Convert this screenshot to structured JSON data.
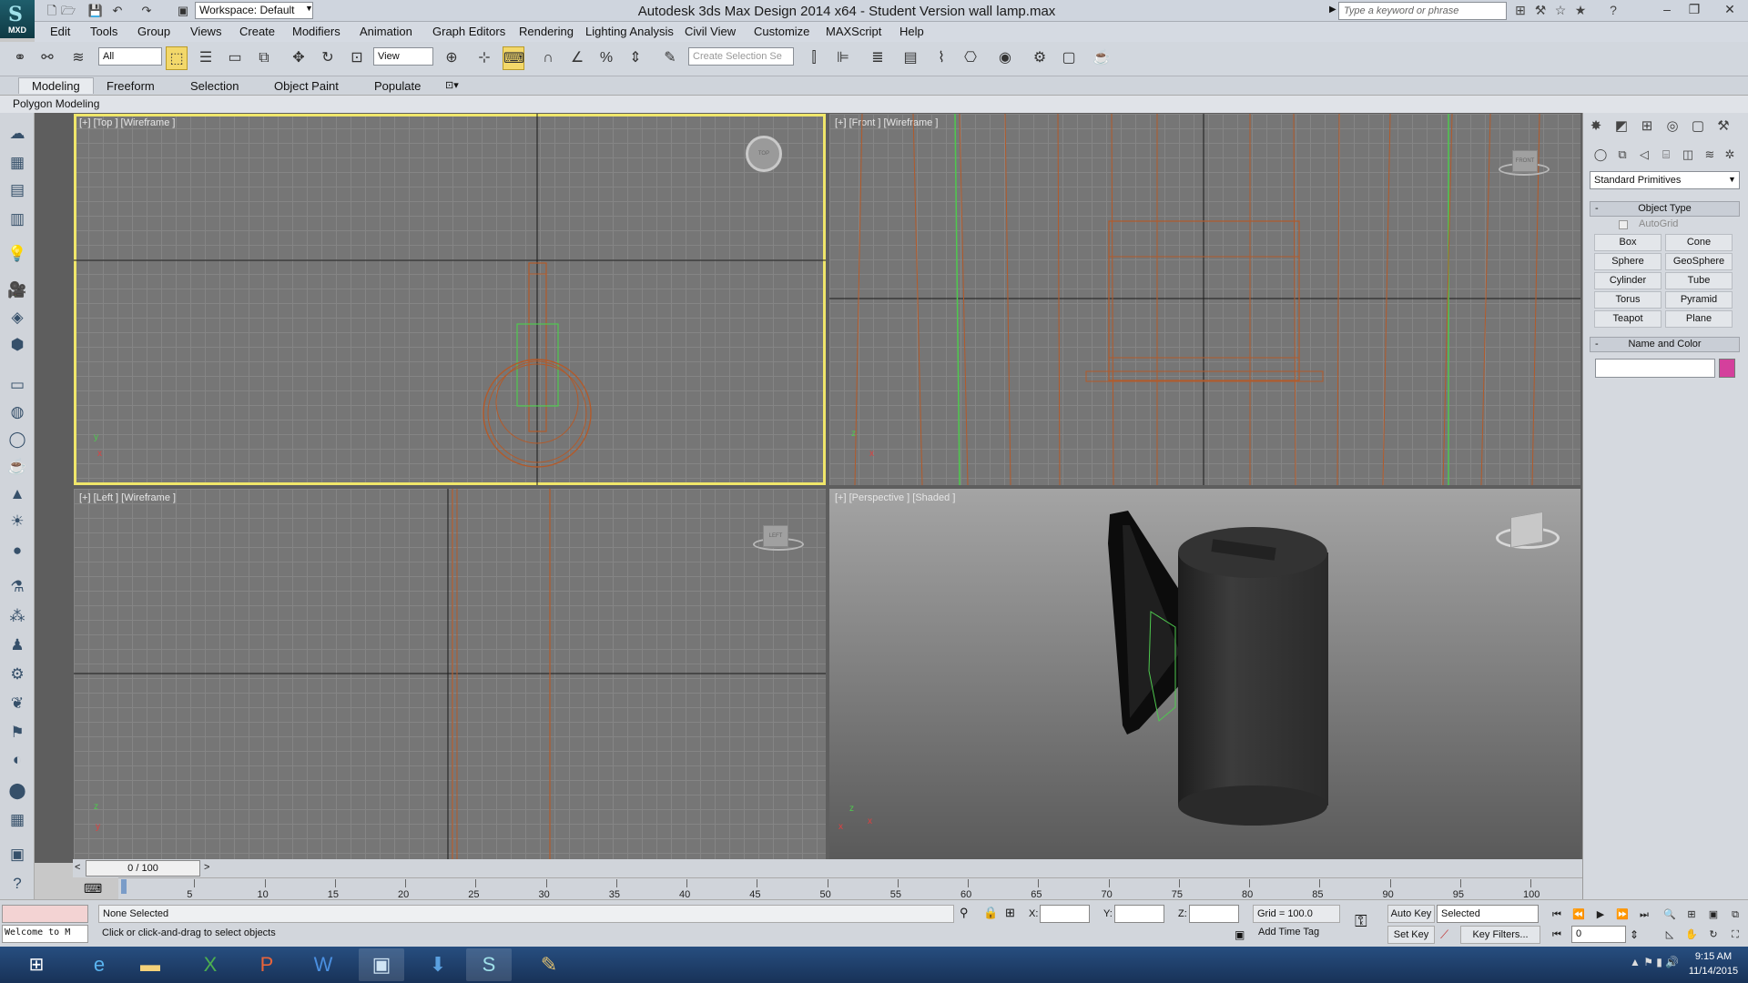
{
  "app": {
    "logo_text": "MXD",
    "title": "Autodesk 3ds Max Design 2014 x64 - Student Version     wall lamp.max",
    "workspace_label": "Workspace: Default",
    "search_placeholder": "Type a keyword or phrase"
  },
  "menu": [
    "Edit",
    "Tools",
    "Group",
    "Views",
    "Create",
    "Modifiers",
    "Animation",
    "Graph Editors",
    "Rendering",
    "Lighting Analysis",
    "Civil View",
    "Customize",
    "MAXScript",
    "Help"
  ],
  "toolbar": {
    "filter_value": "All",
    "refcoord_value": "View",
    "selection_set_placeholder": "Create Selection Se"
  },
  "ribbon": {
    "tabs": [
      "Modeling",
      "Freeform",
      "Selection",
      "Object Paint",
      "Populate"
    ],
    "active_tab": "Modeling",
    "subpanel": "Polygon Modeling"
  },
  "viewports": {
    "top": {
      "label": "[+] [Top ] [Wireframe ]",
      "cube": "TOP"
    },
    "front": {
      "label": "[+] [Front ] [Wireframe ]",
      "cube": "FRONT"
    },
    "left": {
      "label": "[+] [Left ] [Wireframe ]",
      "cube": "LEFT"
    },
    "perspective": {
      "label": "[+] [Perspective ] [Shaded ]"
    }
  },
  "command_panel": {
    "dropdown": "Standard Primitives",
    "object_type_title": "Object Type",
    "autogrid": "AutoGrid",
    "buttons": [
      "Box",
      "Cone",
      "Sphere",
      "GeoSphere",
      "Cylinder",
      "Tube",
      "Torus",
      "Pyramid",
      "Teapot",
      "Plane"
    ],
    "name_color_title": "Name and Color",
    "color": "#d4409c"
  },
  "timeline": {
    "slider": "0 / 100",
    "ticks": [
      "5",
      "10",
      "15",
      "20",
      "25",
      "30",
      "35",
      "40",
      "45",
      "50",
      "55",
      "60",
      "65",
      "70",
      "75",
      "80",
      "85",
      "90",
      "95",
      "100"
    ]
  },
  "status": {
    "maxscript_output": "Welcome to M",
    "selection": "None Selected",
    "prompt": "Click or click-and-drag to select objects",
    "x_label": "X:",
    "y_label": "Y:",
    "z_label": "Z:",
    "grid": "Grid = 100.0",
    "add_time_tag": "Add Time Tag",
    "auto_key": "Auto Key",
    "set_key": "Set Key",
    "key_mode": "Selected",
    "key_filters": "Key Filters...",
    "frame": "0"
  },
  "taskbar": {
    "time": "9:15 AM",
    "date": "11/14/2015"
  }
}
